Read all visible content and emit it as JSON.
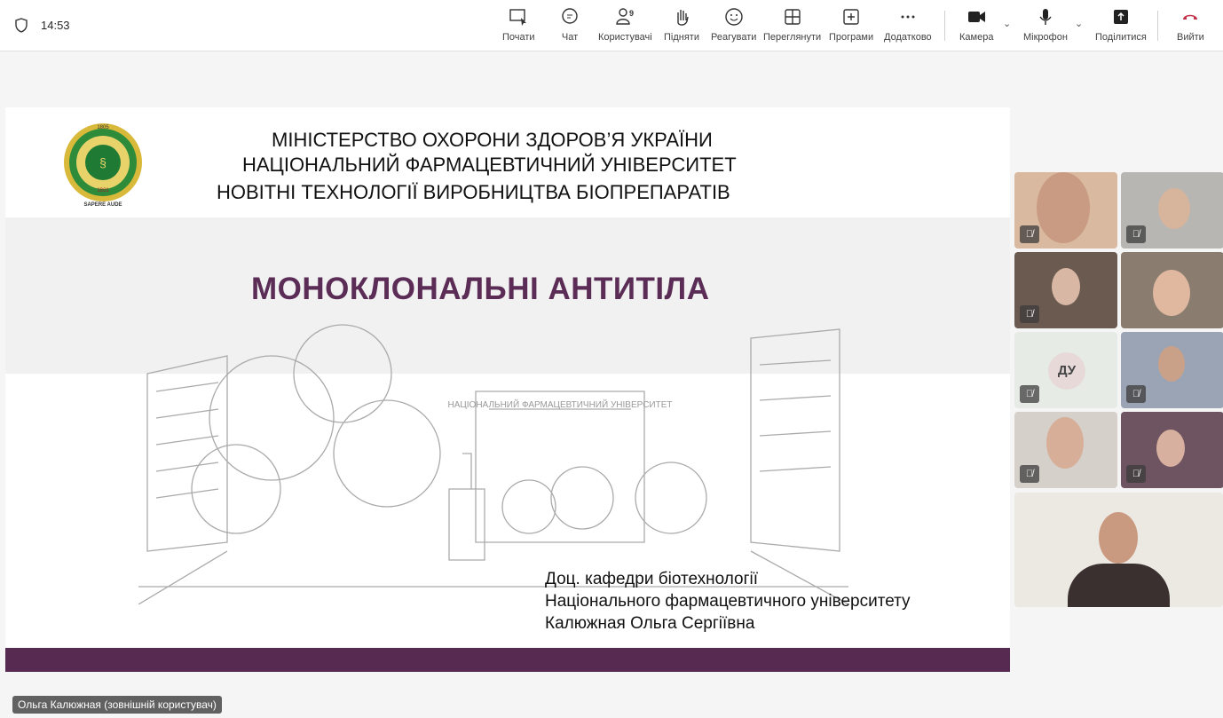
{
  "topbar": {
    "time": "14:53",
    "participants_count": "9",
    "buttons": {
      "start": "Почати",
      "chat": "Чат",
      "users": "Користувачі",
      "raise": "Підняти",
      "react": "Реагувати",
      "view": "Переглянути",
      "apps": "Програми",
      "more": "Додатково",
      "camera": "Камера",
      "mic": "Мікрофон",
      "share": "Поділитися",
      "leave": "Вийти"
    }
  },
  "slide": {
    "line1": "МІНІСТЕРСТВО ОХОРОНИ ЗДОРОВ’Я УКРАЇНИ",
    "line2": "НАЦІОНАЛЬНИЙ ФАРМАЦЕВТИЧНИЙ УНІВЕРСИТЕТ",
    "line3": "НОВІТНІ ТЕХНОЛОГІЇ ВИРОБНИЦТВА БІОПРЕПАРАТІВ",
    "title": "МОНОКЛОНАЛЬНІ АНТИТІЛА",
    "logo_text": [
      "1805",
      "1921",
      "SAPERE AUDE"
    ],
    "building_sign": "НАЦІОНАЛЬНИЙ ФАРМАЦЕВТИЧНИЙ УНІВЕРСИТЕТ",
    "author": [
      "Доц. кафедри біотехнології",
      "Національного фармацевтичного університету",
      "Калюжная Ольга Сергіївна"
    ]
  },
  "participants": {
    "initials_tile": "ДУ"
  },
  "presenter_label": "Ольга Калюжная (зовнішній користувач)",
  "colors": {
    "accent": "#572a51",
    "leave": "#c4314b"
  }
}
